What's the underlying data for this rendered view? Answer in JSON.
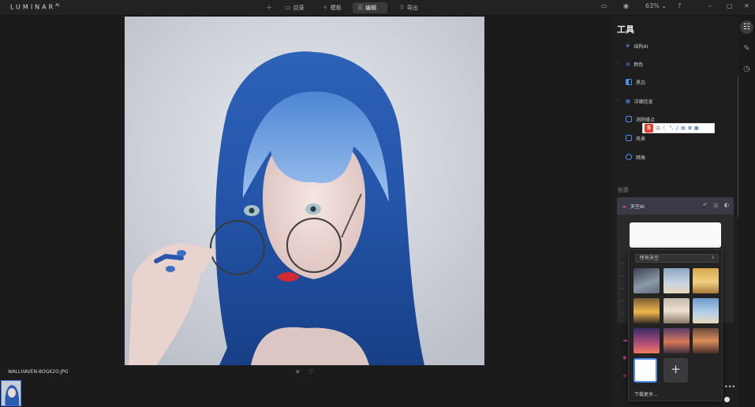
{
  "app": {
    "logo": "LUMINAR",
    "logo_sup": "AI"
  },
  "toolbar": {
    "add_icon": "plus-icon",
    "catalog": "目录",
    "templates": "模板",
    "edit": "编辑",
    "export": "导出",
    "zoom": "63%"
  },
  "image": {
    "filename": "WALLHAVEN-8OGK2O.JPG"
  },
  "panel": {
    "title": "工具",
    "tools": [
      {
        "label": "结构AI"
      },
      {
        "label": "颜色"
      },
      {
        "label": "黑白"
      },
      {
        "label": "详细信息"
      },
      {
        "label": "消除噪点"
      },
      {
        "label": "风景"
      },
      {
        "label": "暗角"
      }
    ],
    "section": "创意",
    "sky_tool": {
      "label": "天空AI"
    }
  },
  "sky_dropdown": {
    "selected": "所有天空",
    "more": "下载更多..."
  },
  "ime": {
    "logo": "S",
    "text": "中"
  },
  "colors": {
    "accent": "#4b8ff0",
    "pink": "#e04a9a"
  }
}
